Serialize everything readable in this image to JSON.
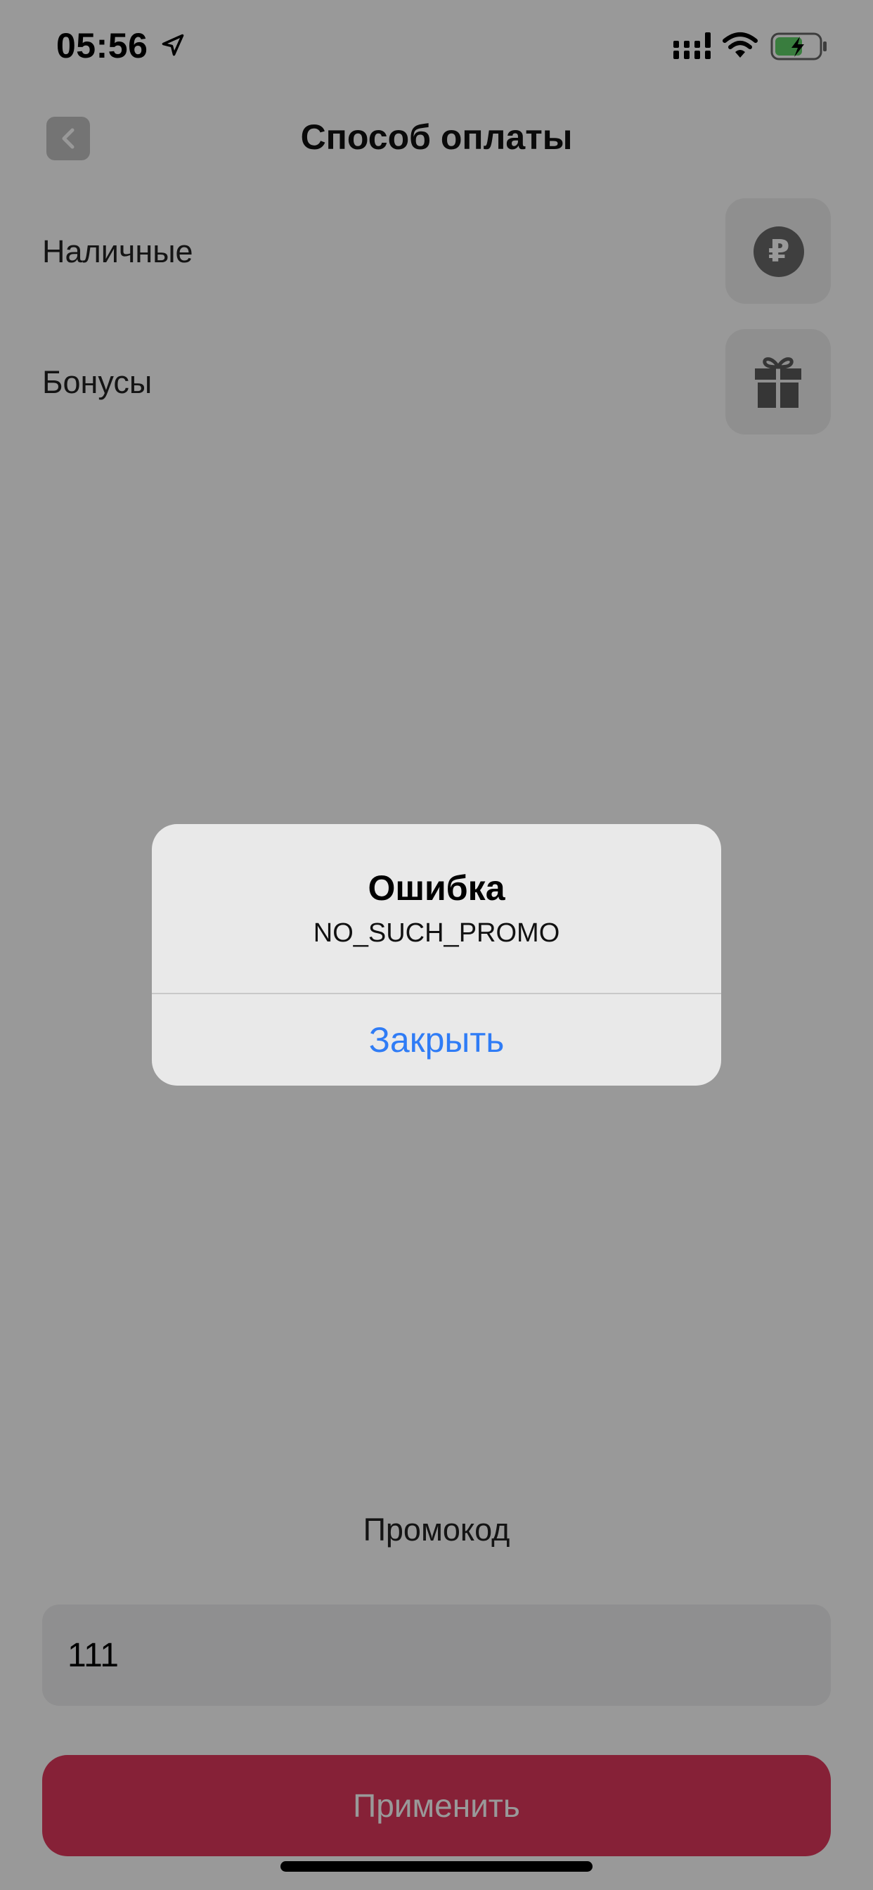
{
  "status_bar": {
    "time": "05:56"
  },
  "header": {
    "title": "Способ оплаты"
  },
  "payment_methods": [
    {
      "label": "Наличные",
      "icon": "ruble-icon",
      "symbol": "₽"
    },
    {
      "label": "Бонусы",
      "icon": "gift-icon"
    }
  ],
  "promo_sheet": {
    "title": "Промокод",
    "input_value": "111",
    "apply_label": "Применить",
    "apply_color": "#e0375c"
  },
  "alert": {
    "title": "Ошибка",
    "message": "NO_SUCH_PROMO",
    "close_label": "Закрыть",
    "accent": "#2f7cf6"
  }
}
